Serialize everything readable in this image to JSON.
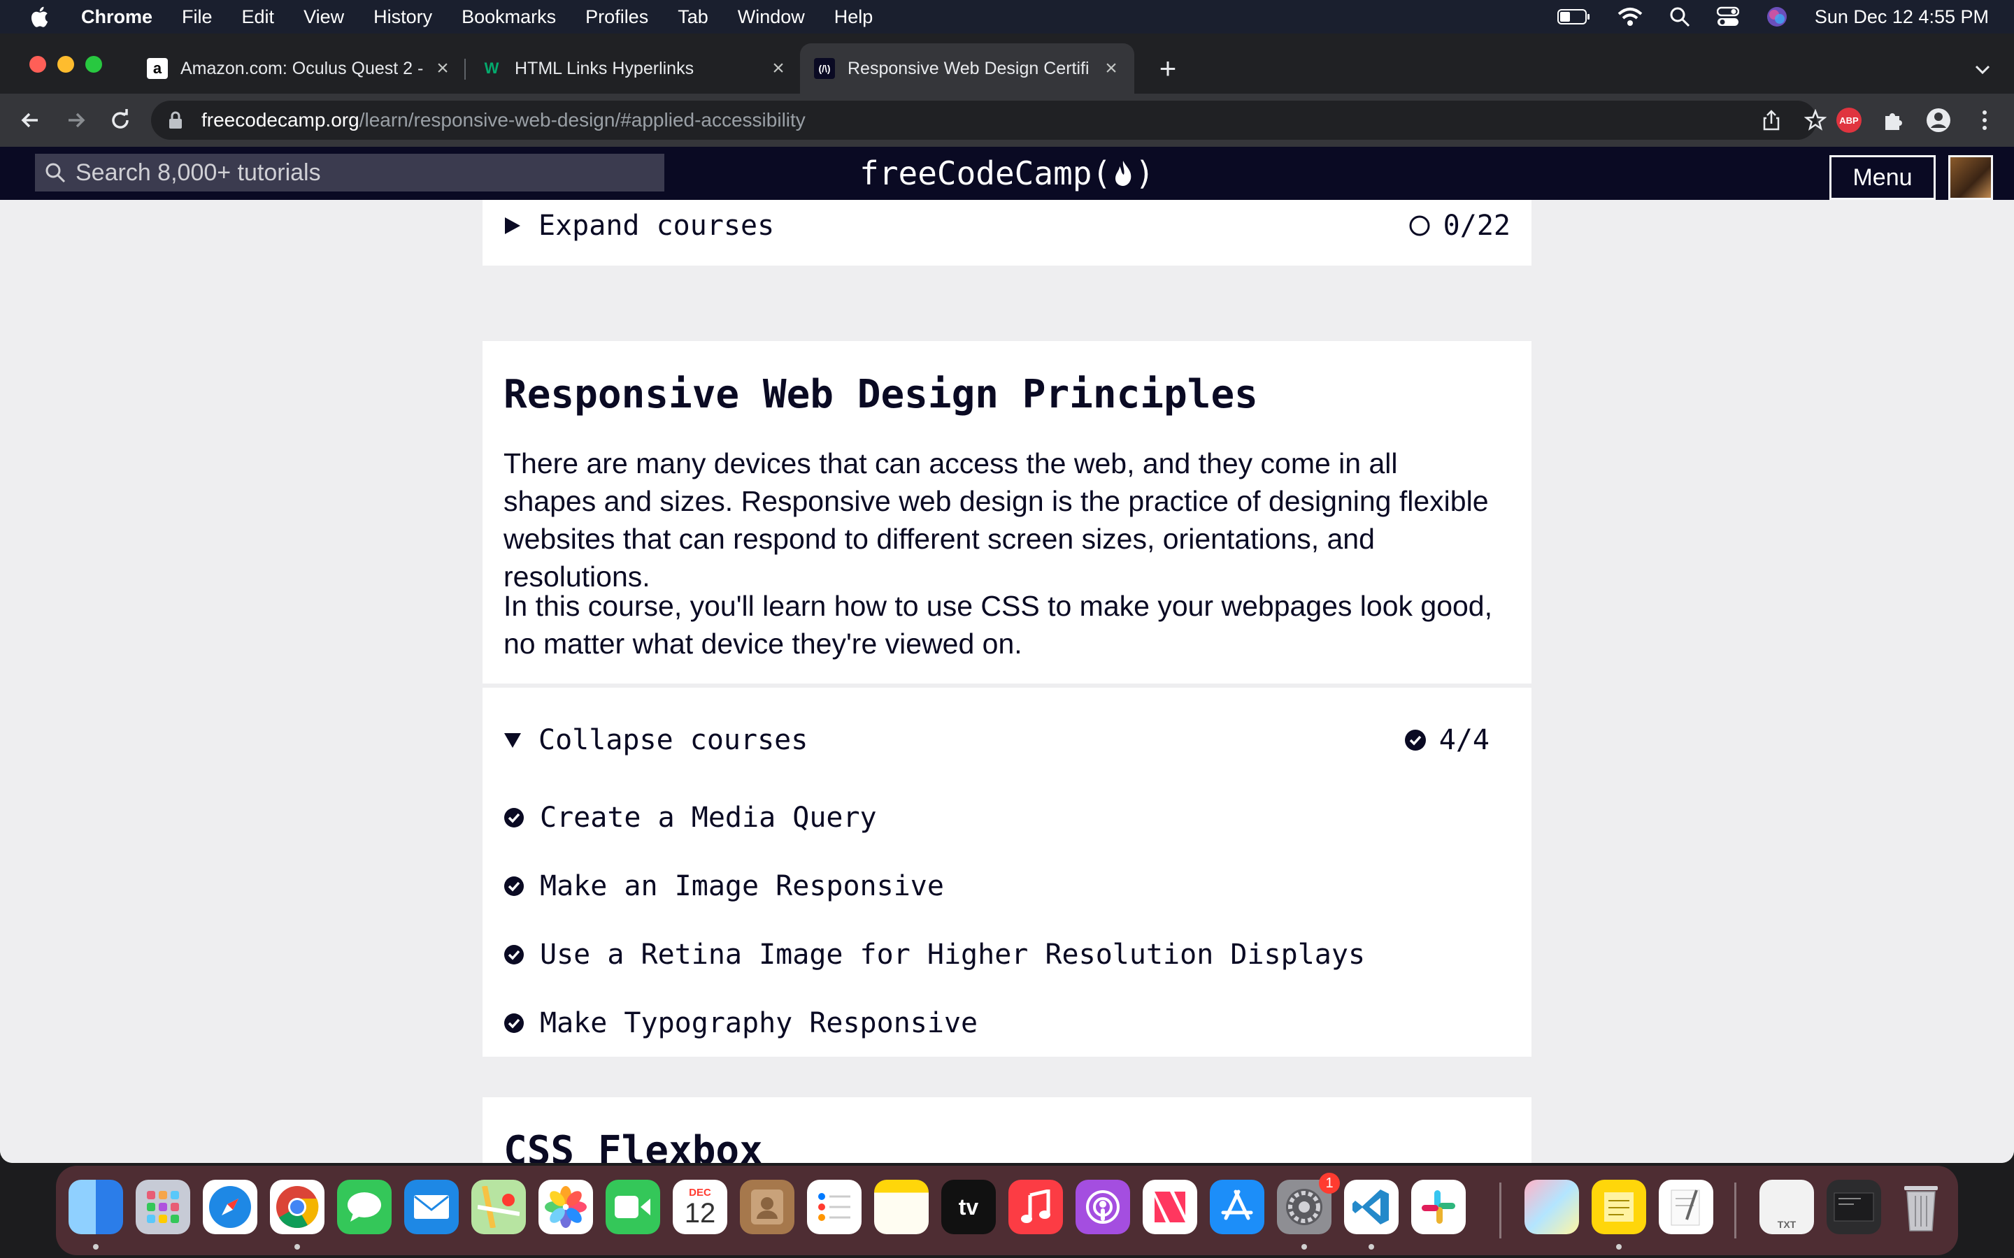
{
  "menubar": {
    "app_name": "Chrome",
    "items": [
      "File",
      "Edit",
      "View",
      "History",
      "Bookmarks",
      "Profiles",
      "Tab",
      "Window",
      "Help"
    ],
    "clock": "Sun Dec 12  4:55 PM"
  },
  "browser": {
    "tabs": [
      {
        "title": "Amazon.com: Oculus Quest 2 -",
        "favicon": "a"
      },
      {
        "title": "HTML Links Hyperlinks",
        "favicon": "W"
      },
      {
        "title": "Responsive Web Design Certifi",
        "favicon": "(/\\)",
        "active": true
      }
    ],
    "address": {
      "host": "freecodecamp.org",
      "path": "/learn/responsive-web-design/#applied-accessibility"
    },
    "extension_abp": "ABP"
  },
  "fcc": {
    "search_placeholder": "Search 8,000+ tutorials",
    "logo": "freeCodeCamp(",
    "logo_end": ")",
    "menu_label": "Menu"
  },
  "prev_block": {
    "expand_label": "Expand courses",
    "progress": "0/22"
  },
  "rwd_block": {
    "title": "Responsive Web Design Principles",
    "paragraph_1": "There are many devices that can access the web, and they come in all shapes and sizes. Responsive web design is the practice of designing flexible websites that can respond to different screen sizes, orientations, and resolutions.",
    "paragraph_2": "In this course, you'll learn how to use CSS to make your webpages look good, no matter what device they're viewed on.",
    "collapse_label": "Collapse courses",
    "progress": "4/4",
    "lessons": [
      "Create a Media Query",
      "Make an Image Responsive",
      "Use a Retina Image for Higher Resolution Displays",
      "Make Typography Responsive"
    ]
  },
  "flexbox_block": {
    "title": "CSS Flexbox"
  },
  "dock": {
    "calendar_month": "DEC",
    "calendar_day": "12",
    "tv_label": "tv",
    "settings_badge": "1",
    "txt_label": "TXT"
  },
  "colors": {
    "fcc_nav": "#0a0a23",
    "fcc_text": "#0a0a23",
    "card_bg": "#ffffff",
    "page_bg": "#eeeef0"
  }
}
